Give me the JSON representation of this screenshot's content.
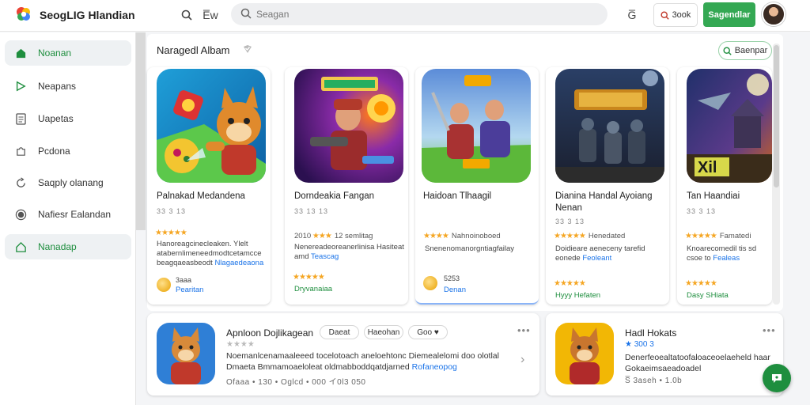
{
  "app": {
    "brand": "SeogLIG Hlandian"
  },
  "header": {
    "search_placeholder": "Seagan",
    "icon_text_1": "E̅w",
    "icon_text_2": "G̅",
    "book_label": "3ook",
    "green_button": "Sagendlar"
  },
  "sidebar": {
    "items": [
      {
        "label": "Noanan",
        "icon": "home-icon"
      },
      {
        "label": "Neapans",
        "icon": "play-icon"
      },
      {
        "label": "Uapetas",
        "icon": "document-icon"
      },
      {
        "label": "Pcdona",
        "icon": "puzzle-icon"
      },
      {
        "label": "Saqply olanang",
        "icon": "refresh-icon"
      },
      {
        "label": "Nafiesr Ealandan",
        "icon": "record-icon"
      },
      {
        "label": "Nanadap",
        "icon": "house-outline-icon"
      }
    ]
  },
  "main": {
    "title": "Naragedl Albam",
    "outline_button": "Baenpar",
    "cards": [
      {
        "title": "Palnakad Medandena",
        "sub": "33 3 13",
        "stars": "★★★★★",
        "meta": "",
        "desc": "Hanoreagcinecleaken. Ylelt atabernlimeneedmodtcetamcce beagqaeasbeodt",
        "desc_link": "Nlagaedeaona",
        "coin_text": "3aaa",
        "coin_link": "Pearitan",
        "foot": ""
      },
      {
        "title": "Dorndeakia Fangan",
        "sub": "33 13 13",
        "stars": "★★★",
        "pre": "2010",
        "meta": "12  semlitag",
        "desc": "Nenereadeoreanerlinisa Hasiteat amd",
        "desc_link": "Teascag",
        "foot_stars": "★★★★★",
        "foot": "Dryvanaiaa"
      },
      {
        "title": "Haidoan Tlhaagil",
        "sub": "",
        "stars": "★★★★",
        "meta": "Nahnoinoboed",
        "desc": "Snenenomanorgntiagfailay",
        "coin_text": "5253",
        "coin_link": "Denan"
      },
      {
        "title": "Dianina Handal Ayoiang Nenan",
        "sub": "33 3 13",
        "stars": "★★★★★",
        "meta": "Henedated",
        "desc": "Doidieare aeneceny tarefid eonede",
        "desc_link": "Feoleant",
        "foot_stars": "★★★★★",
        "foot": "Hyyy Hefaten"
      },
      {
        "title": "Tan Haandiai",
        "sub": "33 3 13",
        "stars": "★★★★★",
        "meta": "Famatedi",
        "desc": "Knoarecomedil tis sd csoe to",
        "desc_link": "Fealeas",
        "foot_stars": "★★★★★",
        "foot": "Dasy SHiata"
      }
    ]
  },
  "bottom": {
    "left": {
      "title": "Apnloon Dojlikagean",
      "chips": [
        "Daeat",
        "Haeohan",
        "Goo ♥"
      ],
      "stars": "★★★★",
      "line1": "Noemanlcenamaaleeed tocelotoach aneloehtonc Diemealelomi doo olotlal",
      "line2": "Dmaeta Bmmamoaeloleat oldmabboddqatdjarned",
      "line2_link": "Rofaneopog",
      "small": "Ofaaa • 130 • Oglcd • 000  イ0l3 050"
    },
    "right": {
      "title": "Hadl Hokats",
      "stars": "★",
      "rating_text": "300 3",
      "line1": "Denerfeoealtatoofaloaceoelaeheld haar",
      "line2": "Gokaeimsaeadoadel",
      "small": "S̅ 3aseh • 1.0b"
    }
  },
  "colors": {
    "accent": "#34a853",
    "link": "#1a73e8",
    "star": "#f5a623"
  }
}
